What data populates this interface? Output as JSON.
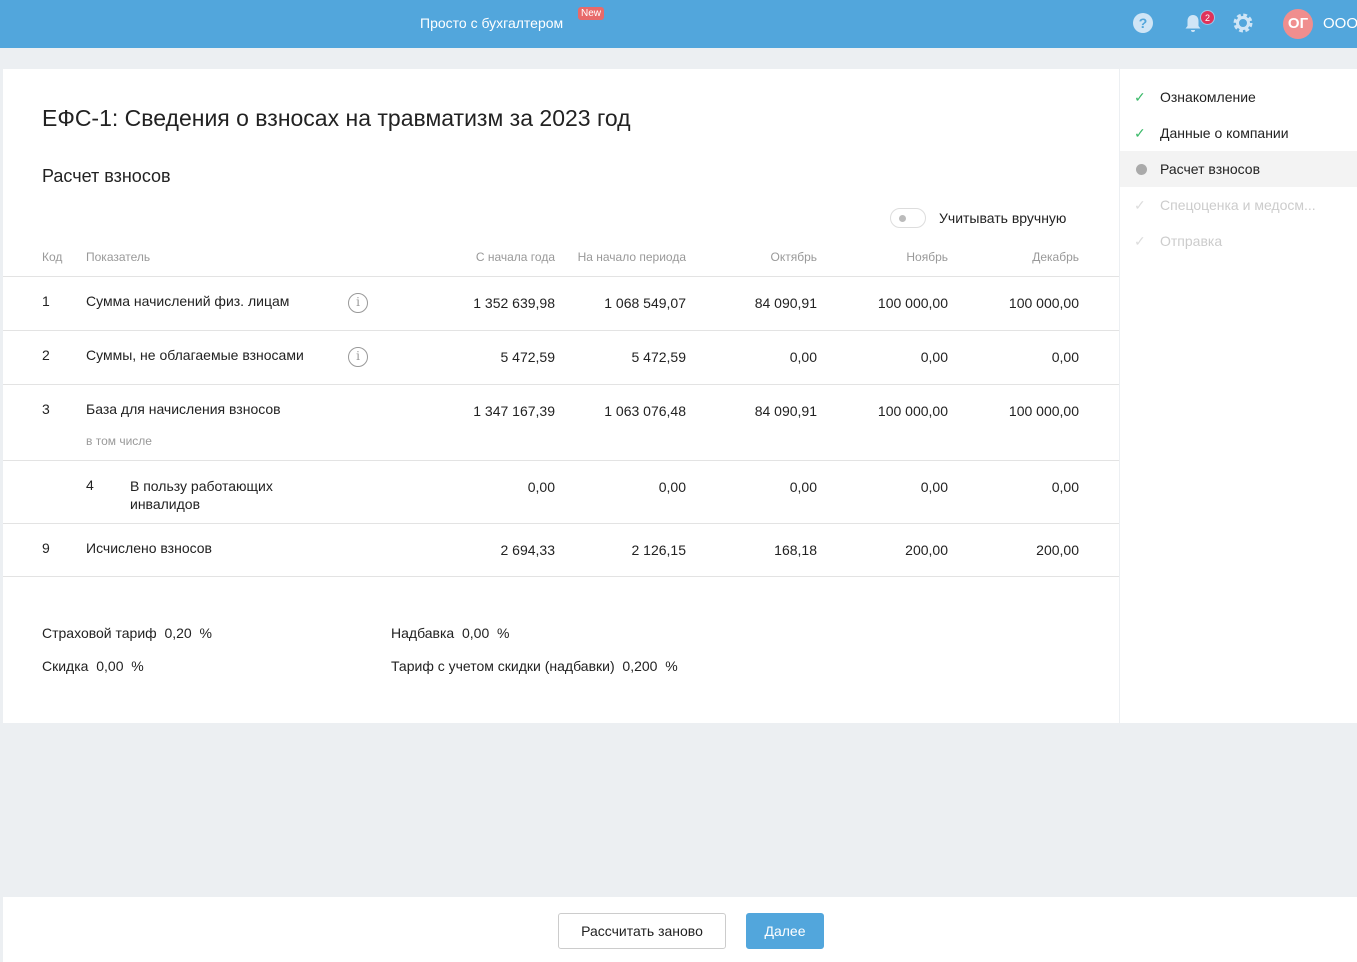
{
  "header": {
    "brand": "Просто с бухгалтером",
    "new_badge": "New",
    "notifications": "2",
    "avatar": "ОГ",
    "org": "ООО"
  },
  "page": {
    "title": "ЕФС-1: Сведения о взносах на травматизм за 2023 год",
    "section": "Расчет взносов",
    "manual_toggle": "Учитывать вручную"
  },
  "table": {
    "headers": [
      "Код",
      "Показатель",
      "С начала года",
      "На начало периода",
      "Октябрь",
      "Ноябрь",
      "Декабрь"
    ],
    "rows": [
      {
        "code": "1",
        "label": "Сумма начислений физ. лицам",
        "values": [
          "1 352 639,98",
          "1 068 549,07",
          "84 090,91",
          "100 000,00",
          "100 000,00"
        ]
      },
      {
        "code": "2",
        "label": "Суммы, не облагаемые взносами",
        "values": [
          "5 472,59",
          "5 472,59",
          "0,00",
          "0,00",
          "0,00"
        ]
      },
      {
        "code": "3",
        "label": "База для начисления взносов",
        "note": "в том числе",
        "values": [
          "1 347 167,39",
          "1 063 076,48",
          "84 090,91",
          "100 000,00",
          "100 000,00"
        ]
      },
      {
        "code": "4",
        "label": "В пользу работающих инвалидов",
        "values": [
          "0,00",
          "0,00",
          "0,00",
          "0,00",
          "0,00"
        ]
      },
      {
        "code": "9",
        "label": "Исчислено взносов",
        "values": [
          "2 694,33",
          "2 126,15",
          "168,18",
          "200,00",
          "200,00"
        ]
      }
    ]
  },
  "rates": {
    "tariff_label": "Страховой тариф",
    "tariff": "0,20",
    "discount_label": "Скидка",
    "discount": "0,00",
    "surcharge_label": "Надбавка",
    "surcharge": "0,00",
    "final_label": "Тариф с учетом скидки (надбавки)",
    "final": "0,200",
    "pct": "%"
  },
  "steps": [
    {
      "label": "Ознакомление",
      "state": "done"
    },
    {
      "label": "Данные о компании",
      "state": "done"
    },
    {
      "label": "Расчет взносов",
      "state": "current"
    },
    {
      "label": "Спецоценка и медосм...",
      "state": "pending"
    },
    {
      "label": "Отправка",
      "state": "pending"
    }
  ],
  "footer": {
    "recalc": "Рассчитать заново",
    "next": "Далее"
  }
}
